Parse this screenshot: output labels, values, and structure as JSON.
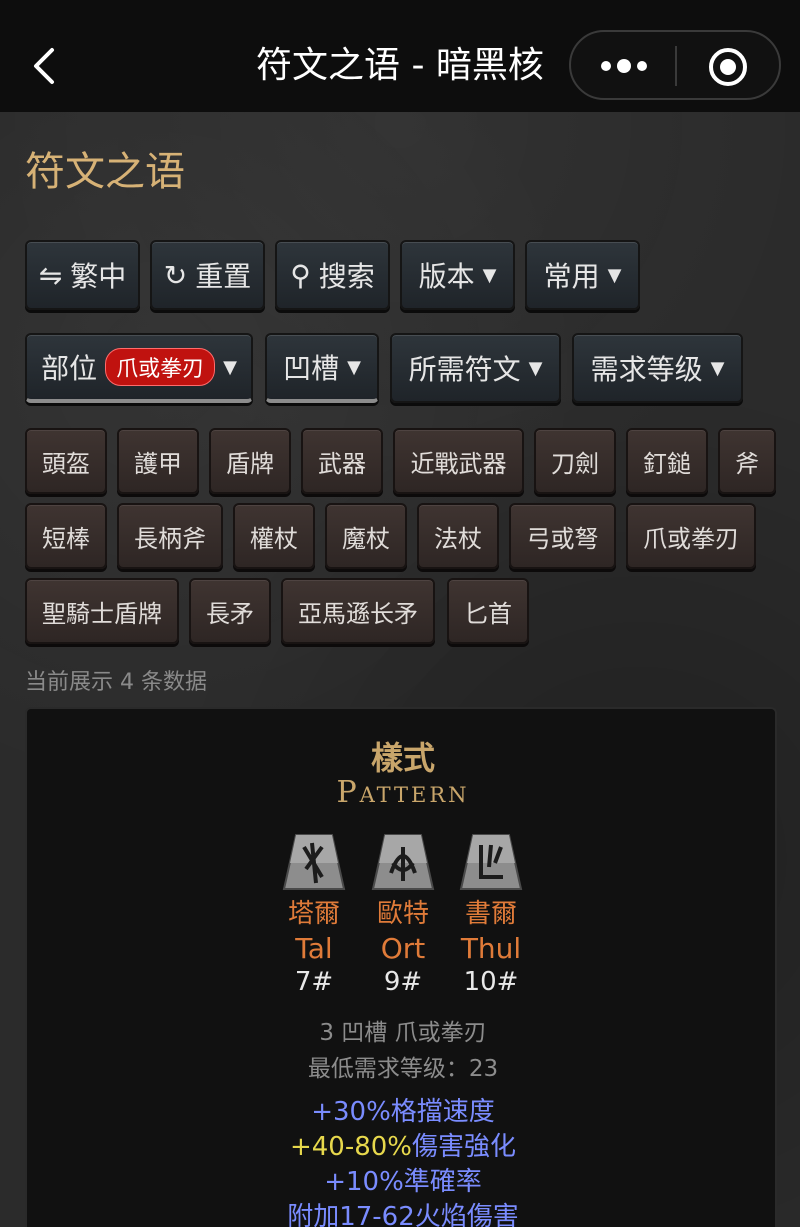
{
  "navbar": {
    "title": "符文之语 - 暗黑核",
    "back_icon": "chevron-left-icon",
    "more_icon": "more-dots-icon",
    "close_icon": "target-circle-icon"
  },
  "heading": "符文之语",
  "toolbar": {
    "lang": {
      "icon": "⇋",
      "label": "繁中"
    },
    "reset": {
      "icon": "↻",
      "label": "重置"
    },
    "search": {
      "icon": "⚲",
      "label": "搜索"
    },
    "version": {
      "label": "版本"
    },
    "common": {
      "label": "常用"
    }
  },
  "filters": {
    "slot": {
      "label": "部位",
      "badge": "爪或拳刃"
    },
    "sockets": {
      "label": "凹槽"
    },
    "runes": {
      "label": "所需符文"
    },
    "level": {
      "label": "需求等级"
    }
  },
  "categories": [
    "頭盔",
    "護甲",
    "盾牌",
    "武器",
    "近戰武器",
    "刀劍",
    "釘鎚",
    "斧",
    "短棒",
    "長柄斧",
    "權杖",
    "魔杖",
    "法杖",
    "弓或弩",
    "爪或拳刃",
    "聖騎士盾牌",
    "長矛",
    "亞馬遜长矛",
    "匕首"
  ],
  "count_text": "当前展示 4 条数据",
  "runeword": {
    "name_cn": "樣式",
    "name_en": "Pattern",
    "runes": [
      {
        "cn": "塔爾",
        "en": "Tal",
        "no": "7#"
      },
      {
        "cn": "歐特",
        "en": "Ort",
        "no": "9#"
      },
      {
        "cn": "書爾",
        "en": "Thul",
        "no": "10#"
      }
    ],
    "sockets_line": "3 凹槽 爪或拳刃",
    "level_line": "最低需求等级：23",
    "stats": {
      "s1": "+30%格擋速度",
      "s2_range": "+40-80%",
      "s2_text": "傷害強化",
      "s3": "+10%準確率",
      "s4": "附加17-62火焰傷害"
    }
  },
  "colors": {
    "gold": "#d7b276",
    "rune_orange": "#e07b39",
    "stat_blue": "#7a8cff",
    "stat_yellow": "#e7d84c",
    "badge_red": "#c0120f"
  }
}
